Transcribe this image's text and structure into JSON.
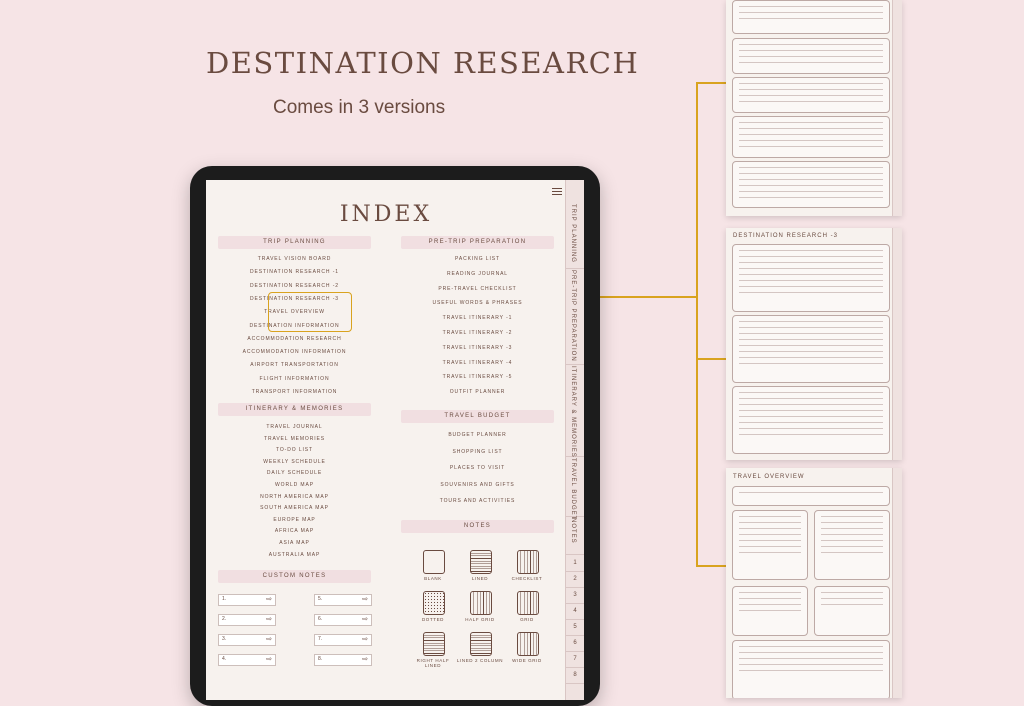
{
  "hero": {
    "title": "DESTINATION RESEARCH",
    "subtitle": "Comes in 3 versions"
  },
  "index": {
    "title": "INDEX",
    "trip_planning": {
      "heading": "TRIP PLANNING",
      "items": [
        "TRAVEL VISION BOARD",
        "DESTINATION RESEARCH -1",
        "DESTINATION RESEARCH -2",
        "DESTINATION RESEARCH -3",
        "TRAVEL OVERVIEW",
        "DESTINATION INFORMATION",
        "ACCOMMODATION RESEARCH",
        "ACCOMMODATION INFORMATION",
        "AIRPORT TRANSPORTATION",
        "FLIGHT INFORMATION",
        "TRANSPORT INFORMATION"
      ]
    },
    "itinerary": {
      "heading": "ITINERARY & MEMORIES",
      "items": [
        "TRAVEL JOURNAL",
        "TRAVEL MEMORIES",
        "TO-DO LIST",
        "WEEKLY SCHEDULE",
        "DAILY SCHEDULE",
        "WORLD MAP",
        "NORTH AMERICA MAP",
        "SOUTH AMERICA MAP",
        "EUROPE MAP",
        "AFRICA MAP",
        "ASIA MAP",
        "AUSTRALIA MAP"
      ]
    },
    "custom_notes": {
      "heading": "CUSTOM NOTES",
      "left": [
        "1.",
        "2.",
        "3.",
        "4."
      ],
      "right": [
        "5.",
        "6.",
        "7.",
        "8."
      ]
    },
    "pre_trip": {
      "heading": "PRE-TRIP PREPARATION",
      "items": [
        "PACKING LIST",
        "READING JOURNAL",
        "PRE-TRAVEL CHECKLIST",
        "USEFUL WORDS & PHRASES",
        "TRAVEL ITINERARY -1",
        "TRAVEL ITINERARY -2",
        "TRAVEL ITINERARY -3",
        "TRAVEL ITINERARY -4",
        "TRAVEL ITINERARY -5",
        "OUTFIT PLANNER"
      ]
    },
    "budget": {
      "heading": "TRAVEL BUDGET",
      "items": [
        "BUDGET PLANNER",
        "SHOPPING LIST",
        "PLACES TO VISIT",
        "SOUVENIRS AND GIFTS",
        "TOURS AND ACTIVITIES"
      ]
    },
    "notes": {
      "heading": "NOTES",
      "types": [
        "BLANK",
        "LINED",
        "CHECKLIST",
        "DOTTED",
        "HALF GRID",
        "GRID",
        "RIGHT HALF LINED",
        "LINED 2 COLUMN",
        "WIDE GRID"
      ]
    }
  },
  "tabs": {
    "sections": [
      "TRIP PLANNING",
      "PRE-TRIP PREPARATION",
      "ITINERARY & MEMORIES",
      "TRAVEL BUDGET",
      "NOTES"
    ],
    "numbers": [
      "1",
      "2",
      "3",
      "4",
      "5",
      "6",
      "7",
      "8"
    ]
  },
  "pages": {
    "page2_title": "DESTINATION RESEARCH -3",
    "page3_title": "TRAVEL OVERVIEW"
  },
  "colors": {
    "background": "#f6e4e6",
    "accent": "#d9a31f",
    "text": "#6a4b40",
    "section_bg": "#f1dfe1"
  }
}
